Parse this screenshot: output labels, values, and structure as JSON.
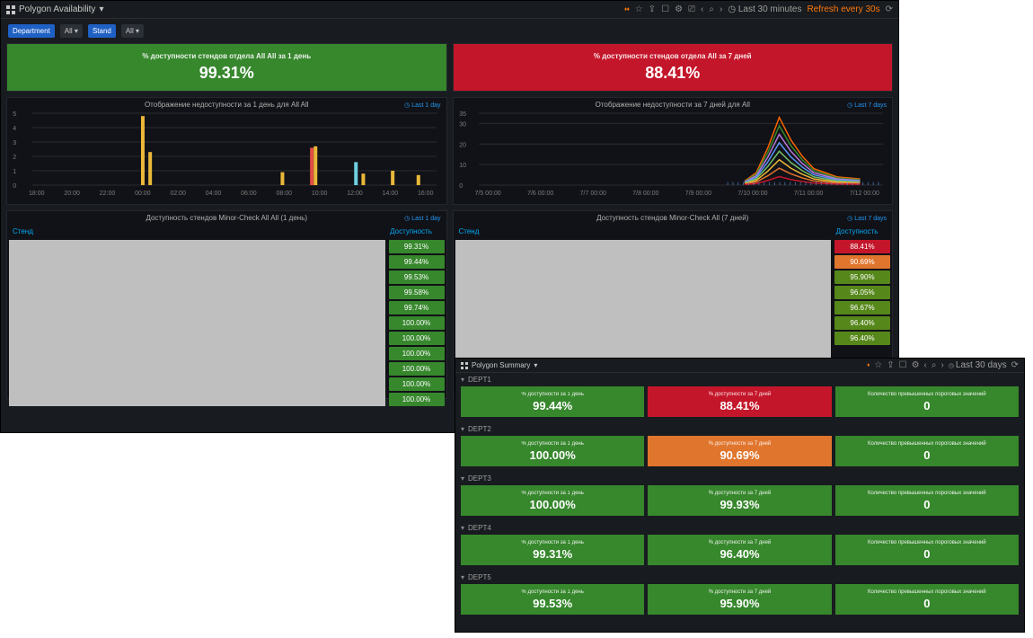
{
  "win1": {
    "title": "Polygon Availability",
    "time_label": "Last 30 minutes",
    "refresh_label": "Refresh every 30s",
    "filters": {
      "department_label": "Department",
      "department_value": "All ▾",
      "stand_label": "Stand",
      "stand_value": "All ▾"
    },
    "stat_left": {
      "label": "% доступности стендов отдела All All за 1 день",
      "value": "99.31%",
      "color": "green"
    },
    "stat_right": {
      "label": "% доступности стендов отдела All за 7 дней",
      "value": "88.41%",
      "color": "red"
    },
    "chart_left": {
      "title": "Отображение недоступности за 1 день для All All",
      "link": "Last 1 day"
    },
    "chart_right": {
      "title": "Отображение недоступности за 7 дней для All",
      "link": "Last 7 days"
    },
    "table_left": {
      "title": "Доступность стендов Minor-Check All All (1 день)",
      "link": "Last 1 day",
      "col_stand": "Стенд",
      "col_avail": "Доступность",
      "values": [
        "99.31%",
        "99.44%",
        "99.53%",
        "99.58%",
        "99.74%",
        "100.00%",
        "100.00%",
        "100.00%",
        "100.00%",
        "100.00%",
        "100.00%"
      ]
    },
    "table_right": {
      "title": "Доступность стендов Minor-Check All (7 дней)",
      "link": "Last 7 days",
      "col_stand": "Стенд",
      "col_avail": "Доступность",
      "values": [
        "88.41%",
        "90.69%",
        "95.90%",
        "96.05%",
        "96.67%",
        "96.40%",
        "96.40%"
      ],
      "value_colors": [
        "red",
        "orange",
        "yellow",
        "yellow",
        "yellow",
        "yellow",
        "yellow"
      ]
    }
  },
  "win2": {
    "title": "Polygon Summary",
    "time_label": "Last 30 days",
    "col_labels": {
      "c1": "% доступности за 1 день",
      "c2": "% доступности за 7 дней",
      "c3": "Количество превышенных пороговых значений"
    },
    "departments": [
      {
        "name": "DEPT1",
        "v1": "99.44%",
        "c1": "green",
        "v2": "88.41%",
        "c2": "red",
        "v3": "0",
        "c3": "green"
      },
      {
        "name": "DEPT2",
        "v1": "100.00%",
        "c1": "green",
        "v2": "90.69%",
        "c2": "orange",
        "v3": "0",
        "c3": "green"
      },
      {
        "name": "DEPT3",
        "v1": "100.00%",
        "c1": "green",
        "v2": "99.93%",
        "c2": "green",
        "v3": "0",
        "c3": "green"
      },
      {
        "name": "DEPT4",
        "v1": "99.31%",
        "c1": "green",
        "v2": "96.40%",
        "c2": "green",
        "v3": "0",
        "c3": "green"
      },
      {
        "name": "DEPT5",
        "v1": "99.53%",
        "c1": "green",
        "v2": "95.90%",
        "c2": "green",
        "v3": "0",
        "c3": "green"
      }
    ]
  },
  "chart_data": [
    {
      "type": "bar",
      "title": "Отображение недоступности за 1 день для All All",
      "ylim": [
        0,
        5
      ],
      "yticks": [
        0,
        1,
        2,
        3,
        4,
        5
      ],
      "x_labels": [
        "18:00",
        "20:00",
        "22:00",
        "00:00",
        "02:00",
        "04:00",
        "06:00",
        "08:00",
        "10:00",
        "12:00",
        "14:00",
        "16:00"
      ],
      "series": [
        {
          "x_index": 3.0,
          "value": 4.8,
          "color": "#eab839"
        },
        {
          "x_index": 3.2,
          "value": 2.3,
          "color": "#eab839"
        },
        {
          "x_index": 6.8,
          "value": 0.9,
          "color": "#eab839"
        },
        {
          "x_index": 7.6,
          "value": 2.6,
          "color": "#e24d42"
        },
        {
          "x_index": 7.7,
          "value": 2.7,
          "color": "#eab839"
        },
        {
          "x_index": 8.8,
          "value": 1.6,
          "color": "#6ed0e0"
        },
        {
          "x_index": 9.0,
          "value": 0.8,
          "color": "#eab839"
        },
        {
          "x_index": 9.8,
          "value": 1.0,
          "color": "#eab839"
        },
        {
          "x_index": 10.5,
          "value": 0.7,
          "color": "#eab839"
        }
      ]
    },
    {
      "type": "area",
      "title": "Отображение недоступности за 7 дней для All",
      "ylim": [
        0,
        35
      ],
      "yticks": [
        0,
        10,
        20,
        30,
        35
      ],
      "x_labels": [
        "7/5 00:00",
        "7/6 00:00",
        "7/7 00:00",
        "7/8 00:00",
        "7/9 00:00",
        "7/10 00:00",
        "7/11 00:00",
        "7/12 00:00"
      ],
      "peak": {
        "x_index": 5.2,
        "value": 33
      },
      "profile_x": [
        4.6,
        4.8,
        5.0,
        5.2,
        5.4,
        5.6,
        5.8,
        6.2,
        6.6
      ],
      "profile_y": [
        2,
        6,
        18,
        33,
        22,
        14,
        8,
        4,
        3
      ]
    }
  ]
}
